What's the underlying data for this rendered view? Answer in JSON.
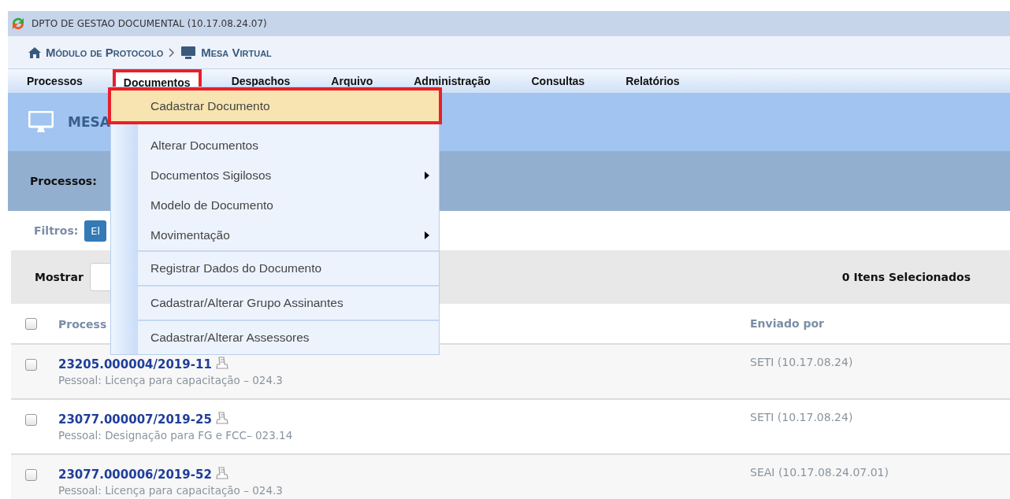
{
  "header": {
    "unit": "DPTO DE GESTAO DOCUMENTAL (10.17.08.24.07)"
  },
  "breadcrumb": [
    "Módulo de Protocolo",
    "Mesa Virtual"
  ],
  "menu_bar": [
    {
      "label": "Processos",
      "selected": false
    },
    {
      "label": "Documentos",
      "selected": true
    },
    {
      "label": "Despachos",
      "selected": false
    },
    {
      "label": "Arquivo",
      "selected": false
    },
    {
      "label": "Administração",
      "selected": false
    },
    {
      "label": "Consultas",
      "selected": false
    },
    {
      "label": "Relatórios",
      "selected": false
    }
  ],
  "dropdown": [
    {
      "label": "Cadastrar Documento",
      "selected": true,
      "has_submenu": false,
      "divider_above": false
    },
    {
      "label": "Alterar Documentos",
      "selected": false,
      "has_submenu": false,
      "divider_above": false
    },
    {
      "label": "Documentos Sigilosos",
      "selected": false,
      "has_submenu": true,
      "divider_above": false
    },
    {
      "label": "Modelo de Documento",
      "selected": false,
      "has_submenu": false,
      "divider_above": false
    },
    {
      "label": "Movimentação",
      "selected": false,
      "has_submenu": true,
      "divider_above": false
    },
    {
      "label": "Registrar Dados do Documento",
      "selected": false,
      "has_submenu": false,
      "divider_above": true
    },
    {
      "label": "Cadastrar/Alterar Grupo Assinantes",
      "selected": false,
      "has_submenu": false,
      "divider_above": true
    },
    {
      "label": "Cadastrar/Alterar Assessores",
      "selected": false,
      "has_submenu": false,
      "divider_above": true
    }
  ],
  "banner": {
    "title": "MESA"
  },
  "process_bar": {
    "label": "Processos:"
  },
  "filters": {
    "label": "Filtros:",
    "button": "El"
  },
  "toolbar": {
    "show_label": "Mostrar",
    "selected_count": "0 Itens Selecionados"
  },
  "table": {
    "columns": [
      "Process",
      "Enviado por"
    ],
    "all_checked": false,
    "rows": [
      {
        "number": "23205.000004/2019-11",
        "subject": "Pessoal: Licença para capacitação – 024.3",
        "sent_by": "SETI (10.17.08.24)",
        "checked": false
      },
      {
        "number": "23077.000007/2019-25",
        "subject": "Pessoal: Designação para FG e FCC– 023.14",
        "sent_by": "SETI (10.17.08.24)",
        "checked": false
      },
      {
        "number": "23077.000006/2019-52",
        "subject": "Pessoal: Licença para capacitação – 024.3",
        "sent_by": "SEAI (10.17.08.24.07.01)",
        "checked": false
      }
    ]
  }
}
